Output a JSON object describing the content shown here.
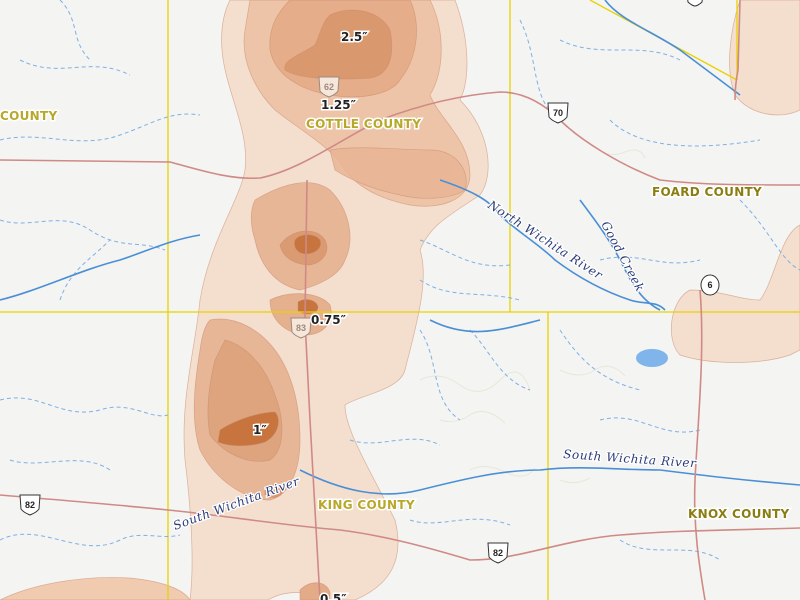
{
  "counties": [
    {
      "label": "COUNTY"
    },
    {
      "label": "COTTLE COUNTY"
    },
    {
      "label": "FOARD COUNTY"
    },
    {
      "label": "KING COUNTY"
    },
    {
      "label": "KNOX COUNTY"
    }
  ],
  "rainfall_labels": [
    "2.5″",
    "1.25″",
    "0.75″",
    "1″",
    "0.5″"
  ],
  "rivers": [
    {
      "label": "North Wichita River"
    },
    {
      "label": "Good Creek"
    },
    {
      "label": "South Wichita River"
    },
    {
      "label": "South Wichita River"
    }
  ],
  "highways": [
    {
      "number": "70",
      "type": "us"
    },
    {
      "number": "62",
      "type": "us"
    },
    {
      "number": "83",
      "type": "us"
    },
    {
      "number": "82",
      "type": "us"
    },
    {
      "number": "82",
      "type": "us"
    },
    {
      "number": "6",
      "type": "state"
    }
  ],
  "colors": {
    "background": "#f4f4f2",
    "county_line": "#e8d200",
    "road": "#cf8a86",
    "river": "#4a8fd6",
    "stream": "#7fb0e6",
    "rain_light": "#f3d9c8",
    "rain_mid": "#e9b796",
    "rain_dark": "#d68d62",
    "rain_darkest": "#c8743f"
  }
}
